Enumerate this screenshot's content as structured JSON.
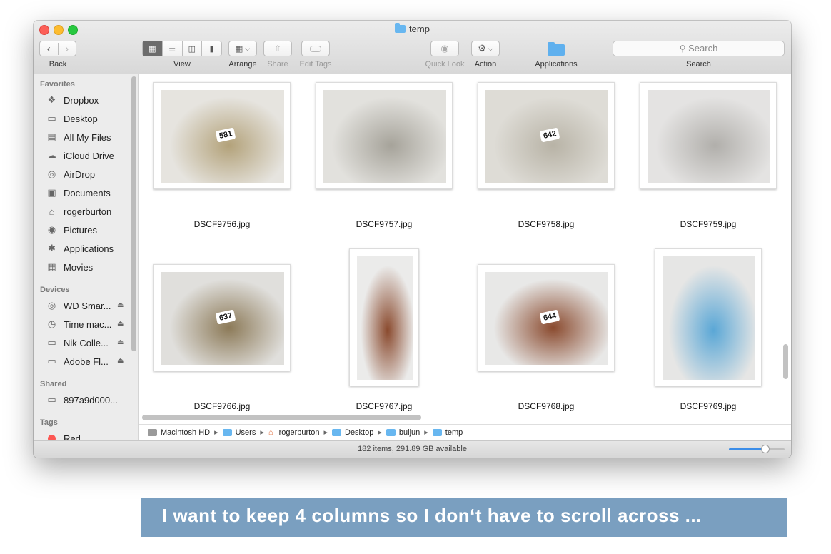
{
  "window": {
    "title": "temp"
  },
  "toolbar": {
    "back_label": "Back",
    "view_label": "View",
    "arrange_label": "Arrange",
    "share_label": "Share",
    "edit_tags_label": "Edit Tags",
    "quick_look_label": "Quick Look",
    "action_label": "Action",
    "applications_label": "Applications",
    "search_label": "Search",
    "search_placeholder": "Search"
  },
  "sidebar": {
    "favorites_header": "Favorites",
    "favorites": [
      {
        "label": "Dropbox",
        "icon": "dropbox-icon"
      },
      {
        "label": "Desktop",
        "icon": "desktop-icon"
      },
      {
        "label": "All My Files",
        "icon": "all-files-icon"
      },
      {
        "label": "iCloud Drive",
        "icon": "cloud-icon"
      },
      {
        "label": "AirDrop",
        "icon": "airdrop-icon"
      },
      {
        "label": "Documents",
        "icon": "documents-icon"
      },
      {
        "label": "rogerburton",
        "icon": "home-icon"
      },
      {
        "label": "Pictures",
        "icon": "camera-icon"
      },
      {
        "label": "Applications",
        "icon": "applications-icon"
      },
      {
        "label": "Movies",
        "icon": "film-icon"
      }
    ],
    "devices_header": "Devices",
    "devices": [
      {
        "label": "WD Smar...",
        "icon": "disk-icon"
      },
      {
        "label": "Time mac...",
        "icon": "time-machine-icon"
      },
      {
        "label": "Nik Colle...",
        "icon": "drive-icon"
      },
      {
        "label": "Adobe Fl...",
        "icon": "drive-icon"
      }
    ],
    "shared_header": "Shared",
    "shared": [
      {
        "label": "897a9d000...",
        "icon": "monitor-icon"
      }
    ],
    "tags_header": "Tags",
    "tags": [
      {
        "label": "Red",
        "color": "#fc5753"
      }
    ]
  },
  "files": [
    {
      "name": "DSCF9756.jpg",
      "tag": "581",
      "tone": [
        "#e6e4df",
        "#b3a27a"
      ]
    },
    {
      "name": "DSCF9757.jpg",
      "tag": "",
      "tone": [
        "#e2e1dd",
        "#a6a39a"
      ]
    },
    {
      "name": "DSCF9758.jpg",
      "tag": "642",
      "tone": [
        "#dedcd6",
        "#b8b3a6"
      ]
    },
    {
      "name": "DSCF9759.jpg",
      "tag": "",
      "tone": [
        "#e4e3e2",
        "#b1afab"
      ]
    },
    {
      "name": "DSCF9766.jpg",
      "tag": "637",
      "tone": [
        "#e0dfdc",
        "#8c7a58"
      ]
    },
    {
      "name": "DSCF9767.jpg",
      "tag": "",
      "tone": [
        "#ebebea",
        "#8a4a2e"
      ]
    },
    {
      "name": "DSCF9768.jpg",
      "tag": "644",
      "tone": [
        "#e8e8e7",
        "#8a4a2e"
      ]
    },
    {
      "name": "DSCF9769.jpg",
      "tag": "",
      "tone": [
        "#e6e6e5",
        "#5aa7d6"
      ]
    }
  ],
  "pathbar": [
    "Macintosh HD",
    "Users",
    "rogerburton",
    "Desktop",
    "buljun",
    "temp"
  ],
  "status": {
    "text": "182 items, 291.89 GB available",
    "icon_size": 0.65
  },
  "caption": "I want to keep 4 columns so I don‘t have to scroll across ..."
}
